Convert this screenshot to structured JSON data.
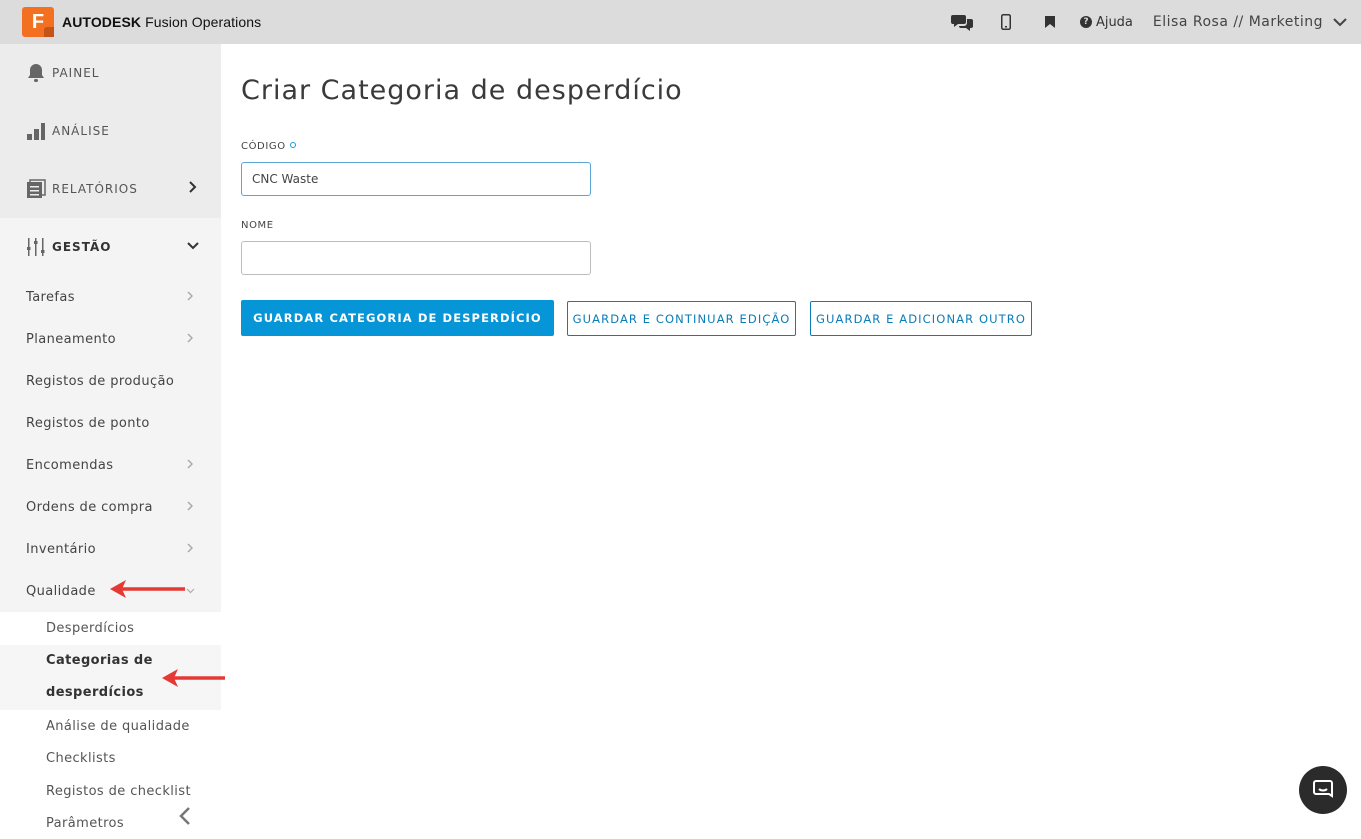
{
  "brand": {
    "logo_letter": "F",
    "name_bold": "AUTODESK",
    "name_rest": " Fusion Operations"
  },
  "topbar": {
    "icons": [
      "chat-icon",
      "mobile-icon",
      "bookmark-icon"
    ],
    "help_label": "Ajuda",
    "user_label": "Elisa Rosa // Marketing"
  },
  "sidebar": {
    "main_items": [
      {
        "label": "PAINEL",
        "icon": "bell-icon"
      },
      {
        "label": "ANÁLISE",
        "icon": "bar-chart-icon"
      },
      {
        "label": "RELATÓRIOS",
        "icon": "reports-icon"
      }
    ],
    "gestao": {
      "label": "GESTÃO",
      "icon": "sliders-icon",
      "items": [
        {
          "label": "Tarefas",
          "has_chevron": true
        },
        {
          "label": "Planeamento",
          "has_chevron": true
        },
        {
          "label": "Registos de produção",
          "has_chevron": false
        },
        {
          "label": "Registos de ponto",
          "has_chevron": false
        },
        {
          "label": "Encomendas",
          "has_chevron": true
        },
        {
          "label": "Ordens de compra",
          "has_chevron": true
        },
        {
          "label": "Inventário",
          "has_chevron": true
        },
        {
          "label": "Qualidade",
          "has_chevron": true
        }
      ],
      "quality_items": [
        {
          "label": "Desperdícios"
        },
        {
          "label_line1": "Categorias de",
          "label_line2": "desperdícios"
        },
        {
          "label": "Análise de qualidade"
        },
        {
          "label": "Checklists"
        },
        {
          "label": "Registos de checklist"
        },
        {
          "label": "Parâmetros"
        }
      ]
    }
  },
  "main": {
    "title": "Criar Categoria de desperdício",
    "code_label": "CÓDIGO",
    "code_value": "CNC Waste",
    "name_label": "NOME",
    "name_value": "",
    "buttons": {
      "save": "GUARDAR CATEGORIA DE DESPERDÍCIO",
      "save_continue": "GUARDAR E CONTINUAR EDIÇÃO",
      "save_add": "GUARDAR E ADICIONAR OUTRO"
    }
  },
  "colors": {
    "accent": "#0696d7",
    "brand": "#f37021",
    "annotation_arrow": "#e53935"
  }
}
